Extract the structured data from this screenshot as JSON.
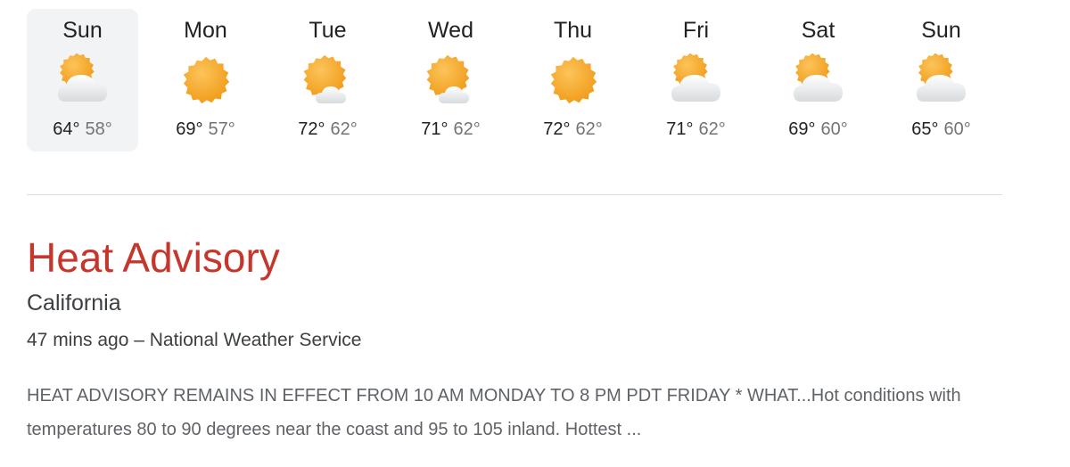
{
  "forecast": {
    "days": [
      {
        "name": "Sun",
        "high": "64°",
        "low": "58°",
        "icon": "partly-cloudy-icon"
      },
      {
        "name": "Mon",
        "high": "69°",
        "low": "57°",
        "icon": "sunny-icon"
      },
      {
        "name": "Tue",
        "high": "72°",
        "low": "62°",
        "icon": "mostly-sunny-icon"
      },
      {
        "name": "Wed",
        "high": "71°",
        "low": "62°",
        "icon": "mostly-sunny-icon"
      },
      {
        "name": "Thu",
        "high": "72°",
        "low": "62°",
        "icon": "sunny-icon"
      },
      {
        "name": "Fri",
        "high": "71°",
        "low": "62°",
        "icon": "partly-cloudy-icon"
      },
      {
        "name": "Sat",
        "high": "69°",
        "low": "60°",
        "icon": "partly-cloudy-icon"
      },
      {
        "name": "Sun",
        "high": "65°",
        "low": "60°",
        "icon": "partly-cloudy-icon"
      }
    ]
  },
  "alert": {
    "title": "Heat Advisory",
    "region": "California",
    "meta": "47 mins ago – National Weather Service",
    "body": "HEAT ADVISORY REMAINS IN EFFECT FROM 10 AM MONDAY TO 8 PM PDT FRIDAY * WHAT...Hot conditions with temperatures 80 to 90 degrees near the coast and 95 to 105 inland. Hottest ..."
  },
  "colors": {
    "alert_title": "#c5372c",
    "sun_light": "#f8b347",
    "sun_dark": "#f29d1b",
    "cloud": "#eceff1",
    "selected_bg": "#f1f3f4"
  }
}
